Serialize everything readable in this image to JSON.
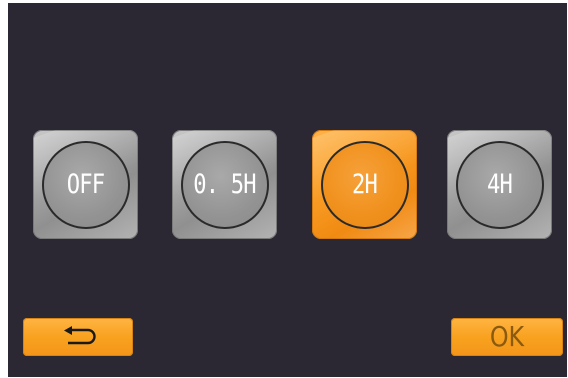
{
  "timer_options": [
    {
      "label": "OFF",
      "selected": false
    },
    {
      "label": "0. 5H",
      "selected": false
    },
    {
      "label": "2H",
      "selected": true
    },
    {
      "label": "4H",
      "selected": false
    }
  ],
  "buttons": {
    "back_icon": "return-arrow-icon",
    "ok_label": "OK"
  },
  "colors": {
    "background": "#2b2833",
    "accent": "#f89a22",
    "tile_gray": "#a6a6a6"
  }
}
